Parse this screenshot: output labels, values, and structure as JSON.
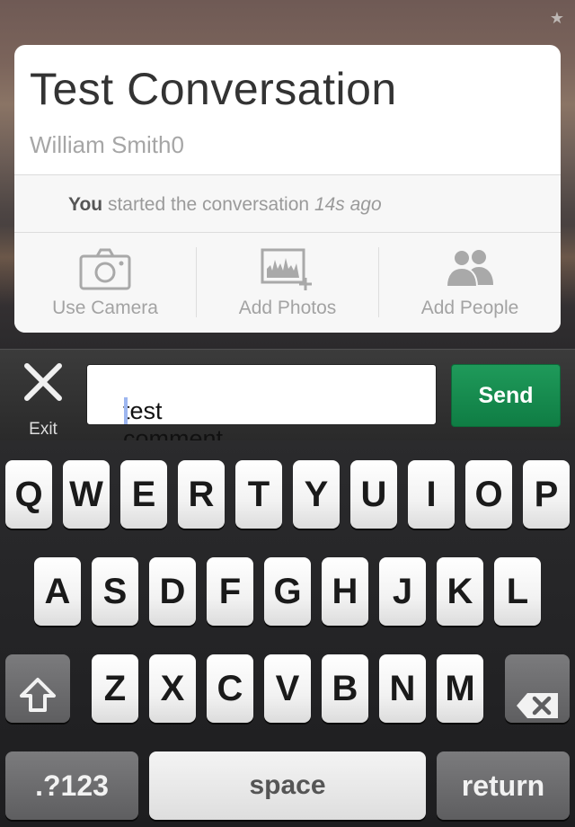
{
  "conversation": {
    "title": "Test Conversation",
    "author": "William Smith0",
    "started": {
      "who": "You",
      "text": "started the conversation",
      "time": "14s ago"
    }
  },
  "actions": [
    {
      "label": "Use Camera",
      "icon": "camera-icon"
    },
    {
      "label": "Add Photos",
      "icon": "add-photos-icon"
    },
    {
      "label": "Add People",
      "icon": "add-people-icon"
    }
  ],
  "comment_bar": {
    "exit_label": "Exit",
    "input_value": "test comment",
    "send_label": "Send"
  },
  "keyboard": {
    "row1": [
      "Q",
      "W",
      "E",
      "R",
      "T",
      "Y",
      "U",
      "I",
      "O",
      "P"
    ],
    "row2": [
      "A",
      "S",
      "D",
      "F",
      "G",
      "H",
      "J",
      "K",
      "L"
    ],
    "row3": [
      "Z",
      "X",
      "C",
      "V",
      "B",
      "N",
      "M"
    ],
    "numbers_label": ".?123",
    "space_label": "space",
    "return_label": "return"
  },
  "colors": {
    "send": "#168a4e",
    "caret": "#9db6f0"
  }
}
